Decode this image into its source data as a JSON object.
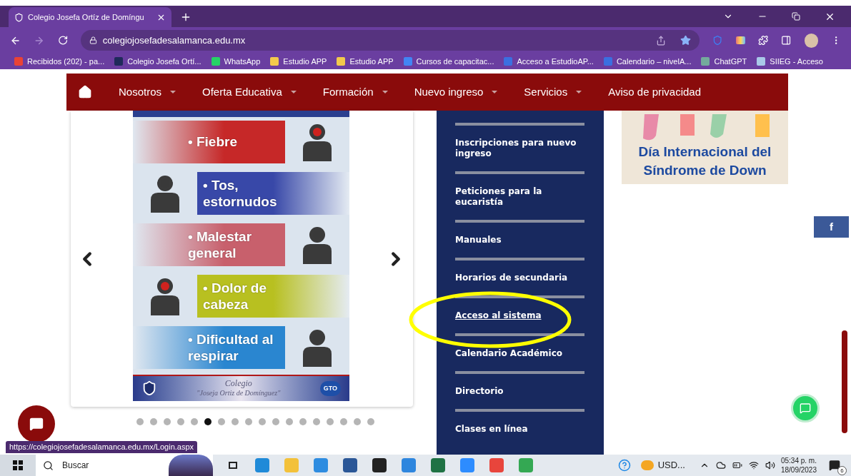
{
  "browser": {
    "tab": {
      "title": "Colegio Josefa Ortíz de Domíngu",
      "selected": true
    },
    "address": "colegiojosefadesalamanca.edu.mx",
    "bookmarks": [
      {
        "label": "Recibidos (202) - pa...",
        "color": "#ea4335"
      },
      {
        "label": "Colegio Josefa Ortí...",
        "color": "#1f2a5a"
      },
      {
        "label": "WhatsApp",
        "color": "#25d366"
      },
      {
        "label": "Estudio APP",
        "color": "#f2c94c"
      },
      {
        "label": "Estudio APP",
        "color": "#f2c94c"
      },
      {
        "label": "Cursos de capacitac...",
        "color": "#4285f4"
      },
      {
        "label": "Acceso a EstudioAP...",
        "color": "#3b6fe0"
      },
      {
        "label": "Calendario – nivelA...",
        "color": "#3b6fe0"
      },
      {
        "label": "ChatGPT",
        "color": "#74aa9c"
      },
      {
        "label": "SIIEG - Acceso",
        "color": "#a9c8e8"
      }
    ]
  },
  "nav": {
    "items": [
      {
        "label": "Nosotros",
        "dropdown": true
      },
      {
        "label": "Oferta Educativa",
        "dropdown": true
      },
      {
        "label": "Formación",
        "dropdown": true
      },
      {
        "label": "Nuevo ingreso",
        "dropdown": true
      },
      {
        "label": "Servicios",
        "dropdown": true
      },
      {
        "label": "Aviso de privacidad",
        "dropdown": false
      }
    ]
  },
  "carousel": {
    "poster": {
      "rows": [
        {
          "text": "• Fiebre",
          "kind": "left",
          "color": "#c62828"
        },
        {
          "text": "• Tos, estornudos",
          "kind": "right",
          "color": "#3848a8"
        },
        {
          "text": "• Malestar general",
          "kind": "left",
          "color": "#c8606c"
        },
        {
          "text": "• Dolor de cabeza",
          "kind": "right",
          "color": "#b8c020"
        },
        {
          "text": "• Dificultad al respirar",
          "kind": "left",
          "color": "#2a86d0"
        }
      ],
      "footer_title": "Colegio",
      "footer_name": "\"Joseja Ortiz de Domínguez\"",
      "footer_badge": "GTO"
    },
    "dots": [
      {
        "selected": false
      },
      {
        "selected": false
      },
      {
        "selected": false
      },
      {
        "selected": false
      },
      {
        "selected": false
      },
      {
        "selected": true
      },
      {
        "selected": false
      },
      {
        "selected": false
      },
      {
        "selected": false
      },
      {
        "selected": false
      },
      {
        "selected": false
      },
      {
        "selected": false
      },
      {
        "selected": false
      },
      {
        "selected": false
      },
      {
        "selected": false
      },
      {
        "selected": false
      },
      {
        "selected": false
      },
      {
        "selected": false
      }
    ]
  },
  "sidebar": {
    "items": [
      {
        "label": "Inscripciones para nuevo ingreso",
        "selected": false
      },
      {
        "label": "Peticiones para la eucaristía",
        "selected": false
      },
      {
        "label": "Manuales",
        "selected": false
      },
      {
        "label": "Horarios de secundaria",
        "selected": false
      },
      {
        "label": "Acceso al sistema",
        "selected": true
      },
      {
        "label": "Calendario Académico",
        "selected": false
      },
      {
        "label": "Directorio",
        "selected": false
      },
      {
        "label": "Clases en línea",
        "selected": false
      }
    ]
  },
  "banner": {
    "text": "Día Internacional del Síndrome de Down"
  },
  "facebook": {
    "label": "f"
  },
  "status_url": "https://colegiojosefadesalamanca.edu.mx/Login.aspx",
  "taskbar": {
    "search_placeholder": "Buscar",
    "tray_label": "USD...",
    "time": "05:34 p. m.",
    "date": "18/09/2023",
    "notifications": "6"
  }
}
